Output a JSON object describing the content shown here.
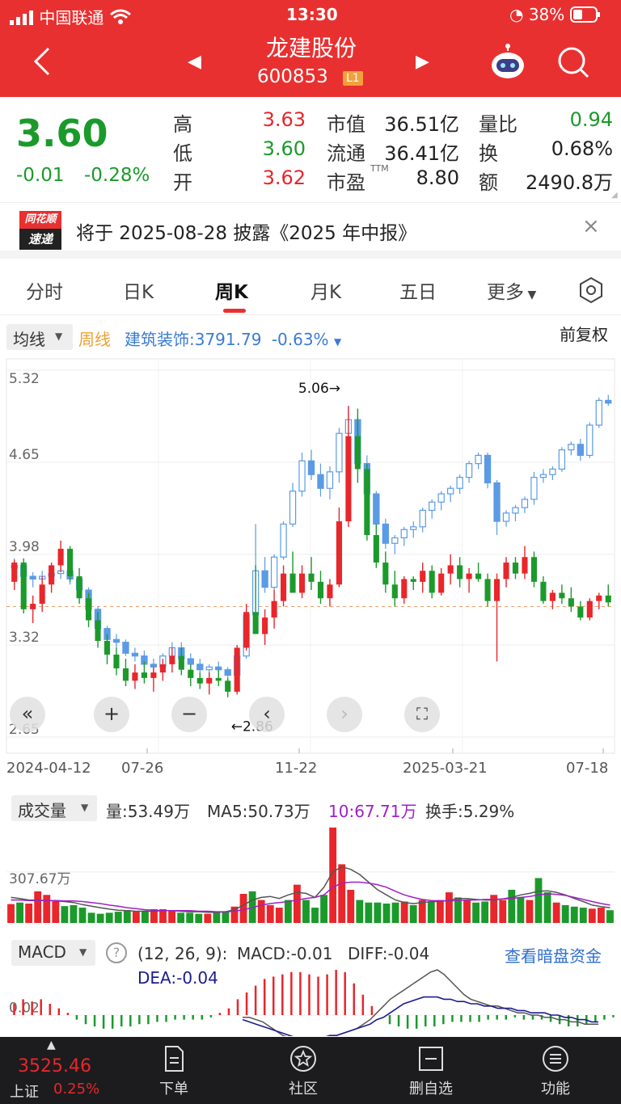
{
  "status_bar": {
    "carrier": "中国联通",
    "time": "13:30",
    "battery": "38%"
  },
  "header": {
    "name": "龙建股份",
    "code": "600853",
    "level_badge": "L1"
  },
  "quote": {
    "price": "3.60",
    "change": "-0.01",
    "change_pct": "-0.28%",
    "high_label": "高",
    "high": "3.63",
    "low_label": "低",
    "low": "3.60",
    "open_label": "开",
    "open": "3.62",
    "mcap_label": "市值",
    "mcap": "36.51亿",
    "float_label": "流通",
    "float": "36.41亿",
    "pe_label": "市盈",
    "pe_sup": "TTM",
    "pe": "8.80",
    "vr_label": "量比",
    "vr": "0.94",
    "turnover_label": "换",
    "turnover": "0.68%",
    "amount_label": "额",
    "amount": "2490.8万"
  },
  "notice": {
    "logo_top": "同花顺",
    "logo_bottom": "速递",
    "text": "将于 2025-08-28 披露《2025 年中报》"
  },
  "tabs": [
    {
      "label": "分时"
    },
    {
      "label": "日K"
    },
    {
      "label": "周K"
    },
    {
      "label": "月K"
    },
    {
      "label": "五日"
    },
    {
      "label": "更多"
    }
  ],
  "chart_toolbar": {
    "ma_selector": "均线",
    "period": "周线",
    "sector": "建筑装饰:3791.79",
    "sector_change": "-0.63%",
    "adjust": "前复权"
  },
  "colors": {
    "up": "#e8262b",
    "down": "#1b9a2b",
    "blue": "#5b9be6",
    "header": "#e93030"
  },
  "chart_data": [
    {
      "type": "candlestick",
      "y_ticks": [
        "5.32",
        "4.65",
        "3.98",
        "3.32",
        "2.65"
      ],
      "ylim": [
        2.65,
        5.32
      ],
      "x_ticks": [
        "2024-04-12",
        "07-26",
        "11-22",
        "2025-03-21",
        "07-18"
      ],
      "annotations": {
        "max": "5.06→",
        "min": "←2.86"
      },
      "candles": [
        [
          3.78,
          3.94,
          3.72,
          3.92
        ],
        [
          3.92,
          3.95,
          3.55,
          3.58
        ],
        [
          3.58,
          3.68,
          3.48,
          3.62
        ],
        [
          3.62,
          3.82,
          3.56,
          3.76
        ],
        [
          3.76,
          3.92,
          3.7,
          3.9
        ],
        [
          3.9,
          4.08,
          3.85,
          4.02
        ],
        [
          4.02,
          4.04,
          3.78,
          3.82
        ],
        [
          3.82,
          3.88,
          3.62,
          3.66
        ],
        [
          3.66,
          3.7,
          3.45,
          3.5
        ],
        [
          3.5,
          3.56,
          3.3,
          3.35
        ],
        [
          3.35,
          3.4,
          3.18,
          3.25
        ],
        [
          3.25,
          3.3,
          3.1,
          3.15
        ],
        [
          3.15,
          3.22,
          3.02,
          3.06
        ],
        [
          3.06,
          3.18,
          3.0,
          3.12
        ],
        [
          3.12,
          3.2,
          3.04,
          3.08
        ],
        [
          3.08,
          3.16,
          2.98,
          3.12
        ],
        [
          3.12,
          3.22,
          3.06,
          3.18
        ],
        [
          3.18,
          3.3,
          3.12,
          3.24
        ],
        [
          3.24,
          3.3,
          3.1,
          3.14
        ],
        [
          3.14,
          3.18,
          3.02,
          3.08
        ],
        [
          3.08,
          3.12,
          3.0,
          3.04
        ],
        [
          3.04,
          3.12,
          2.96,
          3.08
        ],
        [
          3.08,
          3.14,
          3.02,
          3.06
        ],
        [
          3.06,
          3.08,
          2.94,
          2.98
        ],
        [
          2.98,
          3.32,
          2.96,
          3.3
        ],
        [
          3.3,
          3.62,
          3.28,
          3.56
        ],
        [
          3.56,
          3.9,
          3.5,
          3.4
        ],
        [
          3.4,
          3.58,
          3.32,
          3.52
        ],
        [
          3.52,
          3.72,
          3.44,
          3.64
        ],
        [
          3.64,
          3.9,
          3.6,
          3.84
        ],
        [
          3.84,
          4.0,
          3.78,
          3.7
        ],
        [
          3.7,
          3.9,
          3.66,
          3.84
        ],
        [
          3.84,
          3.96,
          3.72,
          3.78
        ],
        [
          3.78,
          3.86,
          3.62,
          3.66
        ],
        [
          3.66,
          3.8,
          3.6,
          3.76
        ],
        [
          3.76,
          4.32,
          3.74,
          4.22
        ],
        [
          4.22,
          5.06,
          4.18,
          4.84
        ],
        [
          4.84,
          5.04,
          4.5,
          4.6
        ],
        [
          4.6,
          4.64,
          4.08,
          4.12
        ],
        [
          4.12,
          4.2,
          3.88,
          3.92
        ],
        [
          3.92,
          4.0,
          3.7,
          3.76
        ],
        [
          3.76,
          3.86,
          3.6,
          3.66
        ],
        [
          3.66,
          3.82,
          3.62,
          3.8
        ],
        [
          3.8,
          3.82,
          3.72,
          3.78
        ],
        [
          3.78,
          3.92,
          3.7,
          3.86
        ],
        [
          3.86,
          3.9,
          3.66,
          3.7
        ],
        [
          3.7,
          3.88,
          3.68,
          3.84
        ],
        [
          3.84,
          3.98,
          3.76,
          3.9
        ],
        [
          3.9,
          3.96,
          3.74,
          3.8
        ],
        [
          3.8,
          3.88,
          3.7,
          3.84
        ],
        [
          3.84,
          3.92,
          3.78,
          3.8
        ],
        [
          3.8,
          3.84,
          3.6,
          3.64
        ],
        [
          3.64,
          3.84,
          3.2,
          3.8
        ],
        [
          3.8,
          3.96,
          3.74,
          3.92
        ],
        [
          3.92,
          3.96,
          3.8,
          3.84
        ],
        [
          3.84,
          4.04,
          3.8,
          3.96
        ],
        [
          3.96,
          4.0,
          3.74,
          3.78
        ],
        [
          3.78,
          3.82,
          3.62,
          3.64
        ],
        [
          3.64,
          3.72,
          3.58,
          3.7
        ],
        [
          3.7,
          3.76,
          3.62,
          3.66
        ],
        [
          3.66,
          3.74,
          3.56,
          3.6
        ],
        [
          3.6,
          3.64,
          3.5,
          3.52
        ],
        [
          3.52,
          3.66,
          3.5,
          3.64
        ],
        [
          3.64,
          3.7,
          3.58,
          3.68
        ],
        [
          3.68,
          3.76,
          3.6,
          3.63
        ]
      ],
      "ma_line": [
        3.9,
        3.86,
        3.82,
        3.8,
        3.8,
        3.82,
        3.84,
        3.8,
        3.74,
        3.66,
        3.58,
        3.48,
        3.4,
        3.33,
        3.28,
        3.24,
        3.23,
        3.24,
        3.24,
        3.2,
        3.18,
        3.16,
        3.15,
        3.13,
        3.14,
        3.22,
        3.34,
        3.46,
        3.6,
        3.75,
        3.9,
        4.0,
        4.15,
        4.3,
        4.45,
        4.6,
        4.7,
        4.8,
        4.8,
        4.7,
        4.6,
        4.45,
        4.2,
        4.12,
        4.1,
        4.12,
        4.14,
        4.18,
        4.24,
        4.3,
        4.34,
        4.38,
        4.44,
        4.5,
        4.52,
        4.5,
        4.46,
        4.4,
        4.3,
        4.2,
        4.26,
        4.3,
        4.36,
        4.46,
        4.56
      ],
      "ma_candles": [
        [
          3.88,
          3.95,
          3.78,
          3.9
        ],
        [
          3.9,
          3.92,
          3.8,
          3.82
        ],
        [
          3.82,
          3.85,
          3.74,
          3.8
        ],
        [
          3.8,
          3.86,
          3.74,
          3.82
        ],
        [
          3.82,
          3.88,
          3.78,
          3.84
        ],
        [
          3.84,
          3.92,
          3.8,
          3.86
        ],
        [
          3.86,
          3.88,
          3.76,
          3.8
        ],
        [
          3.8,
          3.82,
          3.7,
          3.72
        ],
        [
          3.72,
          3.74,
          3.56,
          3.58
        ],
        [
          3.58,
          3.6,
          3.42,
          3.44
        ],
        [
          3.44,
          3.46,
          3.34,
          3.36
        ],
        [
          3.36,
          3.4,
          3.3,
          3.34
        ],
        [
          3.34,
          3.36,
          3.24,
          3.26
        ],
        [
          3.26,
          3.3,
          3.2,
          3.24
        ],
        [
          3.24,
          3.28,
          3.16,
          3.18
        ],
        [
          3.18,
          3.22,
          3.12,
          3.16
        ],
        [
          3.16,
          3.26,
          3.14,
          3.24
        ],
        [
          3.24,
          3.34,
          3.2,
          3.3
        ],
        [
          3.3,
          3.34,
          3.2,
          3.22
        ],
        [
          3.22,
          3.26,
          3.16,
          3.18
        ],
        [
          3.18,
          3.22,
          3.12,
          3.14
        ],
        [
          3.14,
          3.18,
          3.1,
          3.16
        ],
        [
          3.16,
          3.2,
          3.12,
          3.14
        ],
        [
          3.14,
          3.16,
          3.08,
          3.1
        ],
        [
          3.1,
          3.26,
          3.08,
          3.24
        ],
        [
          3.24,
          3.58,
          3.22,
          3.54
        ],
        [
          3.54,
          4.2,
          3.52,
          3.86
        ],
        [
          3.86,
          3.96,
          3.7,
          3.74
        ],
        [
          3.74,
          3.98,
          3.72,
          3.96
        ],
        [
          3.96,
          4.22,
          3.94,
          4.2
        ],
        [
          4.2,
          4.5,
          4.18,
          4.44
        ],
        [
          4.44,
          4.72,
          4.4,
          4.66
        ],
        [
          4.66,
          4.74,
          4.52,
          4.56
        ],
        [
          4.56,
          4.64,
          4.4,
          4.46
        ],
        [
          4.46,
          4.62,
          4.38,
          4.58
        ],
        [
          4.58,
          4.9,
          4.5,
          4.86
        ],
        [
          4.86,
          5.06,
          4.8,
          4.96
        ],
        [
          4.96,
          5.0,
          4.6,
          4.64
        ],
        [
          4.64,
          4.7,
          4.4,
          4.42
        ],
        [
          4.42,
          4.44,
          4.14,
          4.2
        ],
        [
          4.2,
          4.24,
          4.02,
          4.06
        ],
        [
          4.06,
          4.12,
          3.98,
          4.1
        ],
        [
          4.1,
          4.18,
          4.04,
          4.16
        ],
        [
          4.16,
          4.22,
          4.1,
          4.18
        ],
        [
          4.18,
          4.32,
          4.14,
          4.3
        ],
        [
          4.3,
          4.38,
          4.24,
          4.36
        ],
        [
          4.36,
          4.44,
          4.3,
          4.42
        ],
        [
          4.42,
          4.48,
          4.36,
          4.46
        ],
        [
          4.46,
          4.56,
          4.42,
          4.54
        ],
        [
          4.54,
          4.66,
          4.5,
          4.64
        ],
        [
          4.64,
          4.72,
          4.6,
          4.7
        ],
        [
          4.7,
          4.72,
          4.46,
          4.5
        ],
        [
          4.5,
          4.52,
          4.12,
          4.22
        ],
        [
          4.22,
          4.3,
          4.18,
          4.28
        ],
        [
          4.28,
          4.34,
          4.22,
          4.32
        ],
        [
          4.32,
          4.4,
          4.28,
          4.38
        ],
        [
          4.38,
          4.58,
          4.34,
          4.54
        ],
        [
          4.54,
          4.6,
          4.5,
          4.56
        ],
        [
          4.56,
          4.62,
          4.52,
          4.6
        ],
        [
          4.6,
          4.76,
          4.58,
          4.74
        ],
        [
          4.74,
          4.8,
          4.7,
          4.78
        ],
        [
          4.78,
          4.82,
          4.66,
          4.7
        ],
        [
          4.7,
          4.94,
          4.68,
          4.92
        ],
        [
          4.92,
          5.12,
          4.9,
          5.1
        ],
        [
          5.1,
          5.14,
          5.06,
          5.08
        ]
      ]
    },
    {
      "type": "bar",
      "title": "成交量",
      "legend": {
        "vol": "量:53.49万",
        "ma5": "MA5:50.73万",
        "ma10": "10:67.71万",
        "turnover": "换手:5.29%"
      },
      "y_tick": "307.67万",
      "values": [
        0.37,
        0.4,
        0.38,
        0.62,
        0.55,
        0.42,
        0.33,
        0.35,
        0.3,
        0.2,
        0.18,
        0.2,
        0.22,
        0.25,
        0.22,
        0.24,
        0.27,
        0.27,
        0.25,
        0.2,
        0.2,
        0.18,
        0.18,
        0.22,
        0.22,
        0.32,
        0.57,
        0.62,
        0.45,
        0.35,
        0.3,
        0.45,
        0.75,
        0.45,
        0.3,
        0.55,
        1.87,
        1.15,
        0.65,
        0.45,
        0.4,
        0.4,
        0.38,
        0.4,
        0.42,
        0.35,
        0.45,
        0.42,
        0.45,
        0.6,
        0.5,
        0.45,
        0.4,
        0.42,
        0.55,
        0.45,
        0.65,
        0.5,
        0.45,
        0.88,
        0.6,
        0.4,
        0.35,
        0.32,
        0.3,
        0.28,
        0.3,
        0.25
      ],
      "ma5": [
        0.5,
        0.48,
        0.45,
        0.45,
        0.44,
        0.43,
        0.42,
        0.4,
        0.36,
        0.33,
        0.3,
        0.27,
        0.25,
        0.24,
        0.23,
        0.23,
        0.23,
        0.24,
        0.24,
        0.23,
        0.22,
        0.22,
        0.21,
        0.21,
        0.22,
        0.26,
        0.35,
        0.45,
        0.5,
        0.52,
        0.48,
        0.55,
        0.6,
        0.58,
        0.5,
        0.7,
        1.0,
        1.1,
        1.05,
        0.95,
        0.8,
        0.65,
        0.55,
        0.45,
        0.4,
        0.38,
        0.4,
        0.42,
        0.42,
        0.45,
        0.48,
        0.48,
        0.46,
        0.45,
        0.45,
        0.47,
        0.5,
        0.55,
        0.58,
        0.62,
        0.63,
        0.6,
        0.55,
        0.48,
        0.42,
        0.35,
        0.32,
        0.3
      ],
      "ma10": [
        0.45,
        0.45,
        0.44,
        0.44,
        0.44,
        0.44,
        0.43,
        0.43,
        0.42,
        0.4,
        0.38,
        0.35,
        0.33,
        0.3,
        0.28,
        0.26,
        0.25,
        0.24,
        0.24,
        0.24,
        0.24,
        0.23,
        0.23,
        0.22,
        0.22,
        0.23,
        0.26,
        0.3,
        0.35,
        0.38,
        0.4,
        0.42,
        0.45,
        0.48,
        0.5,
        0.55,
        0.7,
        0.78,
        0.8,
        0.8,
        0.78,
        0.75,
        0.7,
        0.62,
        0.55,
        0.5,
        0.46,
        0.44,
        0.43,
        0.43,
        0.44,
        0.45,
        0.45,
        0.46,
        0.46,
        0.47,
        0.48,
        0.5,
        0.52,
        0.55,
        0.57,
        0.56,
        0.54,
        0.5,
        0.46,
        0.42,
        0.38,
        0.35
      ]
    },
    {
      "type": "bar",
      "title": "MACD",
      "legend": {
        "params": "(12, 26, 9):",
        "macd": "MACD:-0.01",
        "diff": "DIFF:-0.04",
        "dea": "DEA:-0.04"
      },
      "link": "查看暗盘资金",
      "y_tick": "0.02",
      "hist": [
        0.05,
        0.07,
        0.06,
        0.07,
        0.05,
        0.03,
        0.01,
        -0.02,
        -0.04,
        -0.05,
        -0.06,
        -0.06,
        -0.05,
        -0.05,
        -0.04,
        -0.04,
        -0.03,
        -0.03,
        -0.02,
        -0.02,
        -0.02,
        -0.02,
        -0.01,
        0.01,
        0.03,
        0.07,
        0.1,
        0.13,
        0.16,
        0.17,
        0.18,
        0.19,
        0.19,
        0.18,
        0.17,
        0.18,
        0.2,
        0.19,
        0.14,
        0.09,
        0.04,
        0.0,
        -0.04,
        -0.05,
        -0.06,
        -0.06,
        -0.05,
        -0.05,
        -0.04,
        -0.03,
        -0.03,
        -0.03,
        -0.03,
        -0.02,
        -0.02,
        -0.02,
        -0.01,
        -0.02,
        -0.02,
        -0.02,
        -0.03,
        -0.04,
        -0.05,
        -0.05,
        -0.04,
        -0.03,
        -0.02,
        -0.01
      ],
      "diff": [
        -0.01,
        -0.01,
        -0.02,
        -0.03,
        -0.05,
        -0.07,
        -0.09,
        -0.1,
        -0.11,
        -0.12,
        -0.12,
        -0.12,
        -0.11,
        -0.1,
        -0.09,
        -0.08,
        -0.07,
        -0.06,
        -0.04,
        -0.02,
        0.01,
        0.04,
        0.07,
        0.09,
        0.11,
        0.13,
        0.15,
        0.17,
        0.19,
        0.2,
        0.18,
        0.15,
        0.12,
        0.09,
        0.07,
        0.06,
        0.05,
        0.04,
        0.04,
        0.03,
        0.02,
        0.01,
        0.01,
        0.0,
        0.0,
        -0.01,
        -0.01,
        -0.02,
        -0.02,
        -0.03,
        -0.03,
        -0.04,
        -0.04,
        -0.04
      ],
      "dea": [
        -0.02,
        -0.03,
        -0.04,
        -0.05,
        -0.06,
        -0.07,
        -0.08,
        -0.09,
        -0.1,
        -0.1,
        -0.1,
        -0.1,
        -0.1,
        -0.09,
        -0.09,
        -0.08,
        -0.07,
        -0.06,
        -0.05,
        -0.04,
        -0.02,
        -0.01,
        0.01,
        0.03,
        0.05,
        0.06,
        0.07,
        0.08,
        0.08,
        0.08,
        0.07,
        0.07,
        0.06,
        0.06,
        0.05,
        0.05,
        0.04,
        0.04,
        0.03,
        0.03,
        0.03,
        0.02,
        0.02,
        0.01,
        0.01,
        0.01,
        0.0,
        0.0,
        -0.01,
        -0.01,
        -0.02,
        -0.02,
        -0.03,
        -0.03
      ]
    }
  ],
  "bottom_bar": {
    "index_value": "3525.46",
    "index_name": "上证",
    "index_change": "0.25%",
    "items": [
      {
        "label": "下单"
      },
      {
        "label": "社区"
      },
      {
        "label": "删自选"
      },
      {
        "label": "功能"
      }
    ]
  }
}
